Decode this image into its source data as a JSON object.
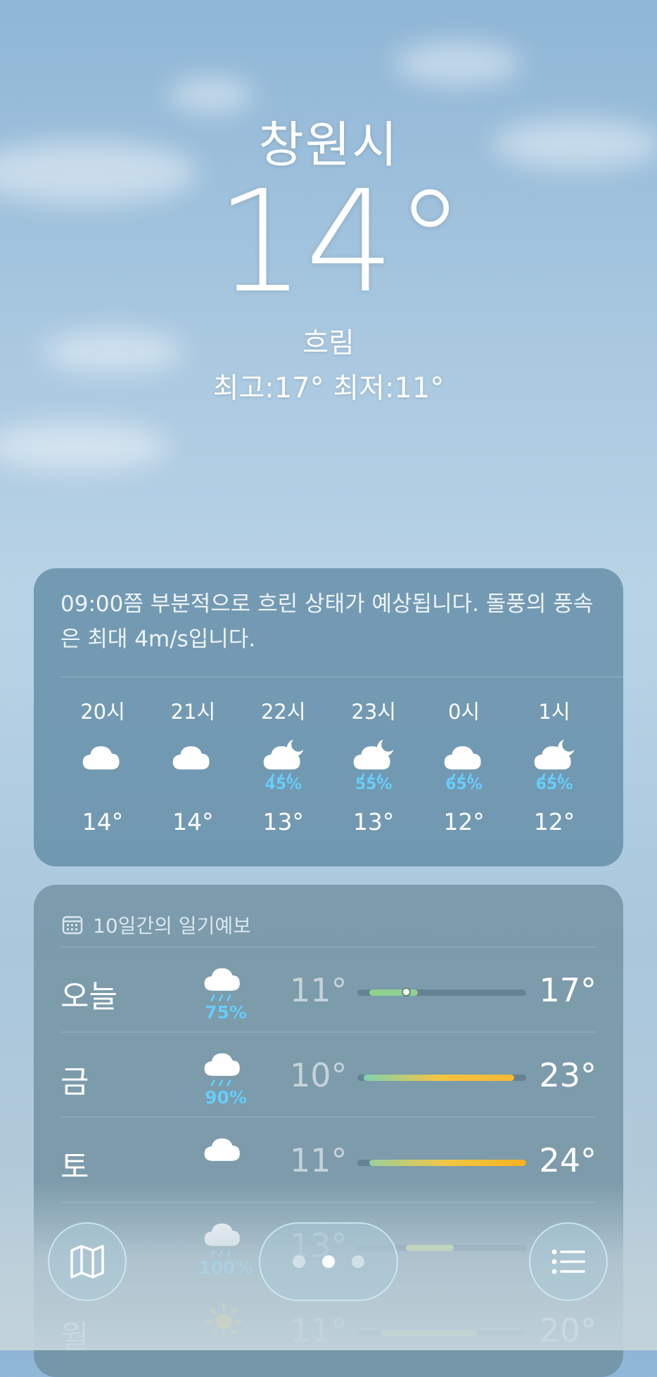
{
  "location": {
    "city": "창원시",
    "temperature": "14°",
    "condition": "흐림",
    "high_low": "최고:17°  최저:11°"
  },
  "hourly": {
    "summary": "09:00쯤 부분적으로 흐린 상태가 예상됩니다. 돌풍의 풍속은 최대 4m/s입니다.",
    "hours": [
      {
        "time": "20시",
        "icon": "cloud-icon",
        "precip": "",
        "temp": "14°"
      },
      {
        "time": "21시",
        "icon": "cloud-icon",
        "precip": "",
        "temp": "14°"
      },
      {
        "time": "22시",
        "icon": "cloud-moon-rain-icon",
        "precip": "45%",
        "temp": "13°"
      },
      {
        "time": "23시",
        "icon": "cloud-moon-rain-icon",
        "precip": "55%",
        "temp": "13°"
      },
      {
        "time": "0시",
        "icon": "cloud-rain-icon",
        "precip": "65%",
        "temp": "12°"
      },
      {
        "time": "1시",
        "icon": "cloud-moon-rain-icon",
        "precip": "65%",
        "temp": "12°"
      }
    ]
  },
  "daily": {
    "header": "10일간의 일기예보",
    "range_min": 10,
    "range_max": 24,
    "days": [
      {
        "day": "오늘",
        "icon": "cloud-rain-icon",
        "precip": "75%",
        "low": "11°",
        "high": "17°",
        "low_val": 11,
        "high_val": 17,
        "bar_from": 11,
        "bar_to": 15,
        "current": 14,
        "bar_color": "#8fd08f"
      },
      {
        "day": "금",
        "icon": "cloud-rain-icon",
        "precip": "90%",
        "low": "10°",
        "high": "23°",
        "low_val": 10,
        "high_val": 23,
        "bar_from": 10.5,
        "bar_to": 23,
        "bar_color": "linear-gradient(90deg,#7dd3b0,#f5c542,#f7b733)"
      },
      {
        "day": "토",
        "icon": "cloud-icon",
        "precip": "",
        "low": "11°",
        "high": "24°",
        "low_val": 11,
        "high_val": 24,
        "bar_from": 11,
        "bar_to": 24,
        "bar_color": "linear-gradient(90deg,#9ccf9a,#f2c744,#f7b21f)"
      },
      {
        "day": "",
        "icon": "cloud-rain-icon",
        "precip": "100%",
        "low": "13°",
        "high": "",
        "low_val": 13,
        "high_val": 18,
        "bar_from": 14,
        "bar_to": 18,
        "bar_color": "#c8d88c"
      },
      {
        "day": "월",
        "icon": "sun-icon",
        "precip": "",
        "low": "11°",
        "high": "20°",
        "low_val": 11,
        "high_val": 20,
        "bar_from": 12,
        "bar_to": 20,
        "bar_color": "#b8d08c"
      }
    ]
  },
  "pager": {
    "pages": 3,
    "active": 1
  },
  "colors": {
    "precip": "#67cdf8"
  }
}
